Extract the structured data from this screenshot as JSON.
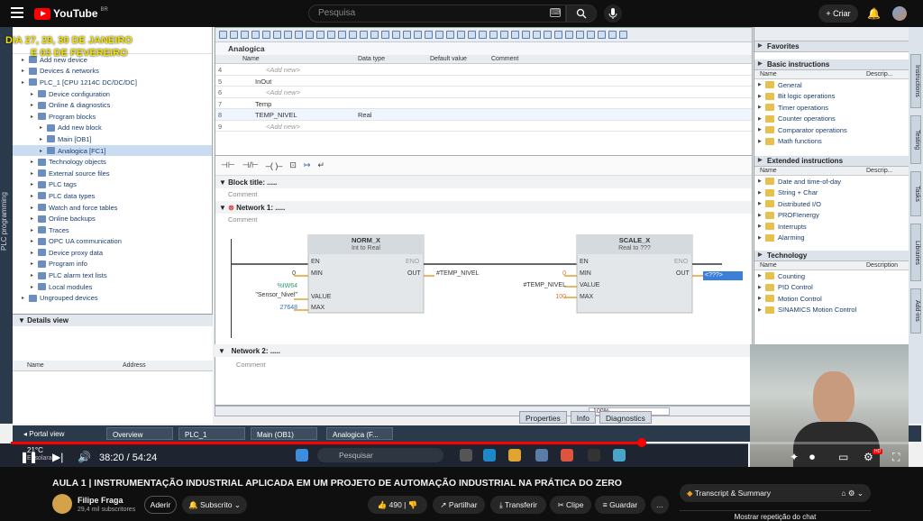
{
  "youtube": {
    "logo": "YouTube",
    "region": "BR",
    "search_placeholder": "Pesquisa",
    "create_label": "Criar"
  },
  "video_overlay": {
    "line1": "DIA 27, 29, 30 DE JANEIRO",
    "line2": "E 03 DE FEVEREIRO"
  },
  "tia": {
    "left_strip": "PLC programming",
    "tree": [
      {
        "label": "Add new device",
        "indent": 1
      },
      {
        "label": "Devices & networks",
        "indent": 1
      },
      {
        "label": "PLC_1 [CPU 1214C DC/DC/DC]",
        "indent": 1
      },
      {
        "label": "Device configuration",
        "indent": 2
      },
      {
        "label": "Online & diagnostics",
        "indent": 2
      },
      {
        "label": "Program blocks",
        "indent": 2
      },
      {
        "label": "Add new block",
        "indent": 3
      },
      {
        "label": "Main [OB1]",
        "indent": 3
      },
      {
        "label": "Analogica [FC1]",
        "indent": 3,
        "selected": true
      },
      {
        "label": "Technology objects",
        "indent": 2
      },
      {
        "label": "External source files",
        "indent": 2
      },
      {
        "label": "PLC tags",
        "indent": 2
      },
      {
        "label": "PLC data types",
        "indent": 2
      },
      {
        "label": "Watch and force tables",
        "indent": 2
      },
      {
        "label": "Online backups",
        "indent": 2
      },
      {
        "label": "Traces",
        "indent": 2
      },
      {
        "label": "OPC UA communication",
        "indent": 2
      },
      {
        "label": "Device proxy data",
        "indent": 2
      },
      {
        "label": "Program info",
        "indent": 2
      },
      {
        "label": "PLC alarm text lists",
        "indent": 2
      },
      {
        "label": "Local modules",
        "indent": 2
      },
      {
        "label": "Ungrouped devices",
        "indent": 1
      }
    ],
    "details_view": {
      "title": "Details view",
      "col_name": "Name",
      "col_address": "Address"
    },
    "block_name": "Analogica",
    "interface": {
      "cols": {
        "name": "Name",
        "type": "Data type",
        "default": "Default value",
        "comment": "Comment"
      },
      "rows": [
        {
          "n": "4",
          "name": "<Add new>",
          "type": "",
          "addnew": true
        },
        {
          "n": "5",
          "name": "InOut",
          "type": ""
        },
        {
          "n": "6",
          "name": "<Add new>",
          "type": "",
          "addnew": true
        },
        {
          "n": "7",
          "name": "Temp",
          "type": ""
        },
        {
          "n": "8",
          "name": "TEMP_NIVEL",
          "type": "Real",
          "selected": true
        },
        {
          "n": "9",
          "name": "<Add new>",
          "type": "",
          "addnew": true
        }
      ]
    },
    "block_title": "Block title:",
    "comment": "Comment",
    "network1": "Network 1:",
    "network2": "Network 2:",
    "norm": {
      "title": "NORM_X",
      "sub": "Int to Real",
      "en": "EN",
      "eno": "ENO",
      "min": "MIN",
      "value": "VALUE",
      "max": "MAX",
      "out": "OUT",
      "min_val": "0",
      "value_addr": "%IW64",
      "value_tag": "\"Sensor_Nivel\"",
      "max_val": "27648",
      "out_val": "#TEMP_NIVEL"
    },
    "scale": {
      "title": "SCALE_X",
      "sub": "Real to ???",
      "en": "EN",
      "eno": "ENO",
      "min": "MIN",
      "value": "VALUE",
      "max": "MAX",
      "out": "OUT",
      "min_val": "0",
      "value_val": "#TEMP_NIVEL",
      "max_val": "100",
      "out_val": "<???>"
    },
    "zoom": "100%",
    "right": {
      "favorites": "Favorites",
      "basic": "Basic instructions",
      "col_name": "Name",
      "col_desc": "Descrip...",
      "basic_items": [
        "General",
        "Bit logic operations",
        "Timer operations",
        "Counter operations",
        "Comparator operations",
        "Math functions"
      ],
      "extended": "Extended instructions",
      "extended_items": [
        "Date and time-of-day",
        "String + Char",
        "Distributed I/O",
        "PROFIenergy",
        "Interrupts",
        "Alarming"
      ],
      "technology": "Technology",
      "col_description": "Description",
      "tech_items": [
        "Counting",
        "PID Control",
        "Motion Control",
        "SINAMICS Motion Control"
      ]
    },
    "vtabs": [
      "Instructions",
      "Testing",
      "Tasks",
      "Libraries",
      "Add-ins"
    ],
    "properties": "Properties",
    "info": "Info",
    "diagnostics": "Diagnostics",
    "portal": {
      "view": "Portal view",
      "items": [
        "Overview",
        "PLC_1",
        "Main (OB1)",
        "Analogica (F..."
      ]
    },
    "taskbar_search": "Pesquisar",
    "weather": "21°C",
    "weather_sub": "Ensolarado"
  },
  "player": {
    "time": "38:20 / 54:24",
    "progress": 0.7
  },
  "video": {
    "title": "AULA 1 | INSTRUMENTAÇÃO INDUSTRIAL APLICADA EM UM PROJETO DE AUTOMAÇÃO INDUSTRIAL NA PRÁTICA DO ZERO",
    "channel": "Filipe Fraga",
    "subs": "29,4 mil subscritores",
    "join": "Aderir",
    "subscribe": "Subscrito",
    "likes": "490",
    "share": "Partilhar",
    "transfer": "Transferir",
    "clip": "Clipe",
    "save": "Guardar",
    "transcript": "Transcript & Summary",
    "live_chat": "Mostrar repetição do chat"
  }
}
